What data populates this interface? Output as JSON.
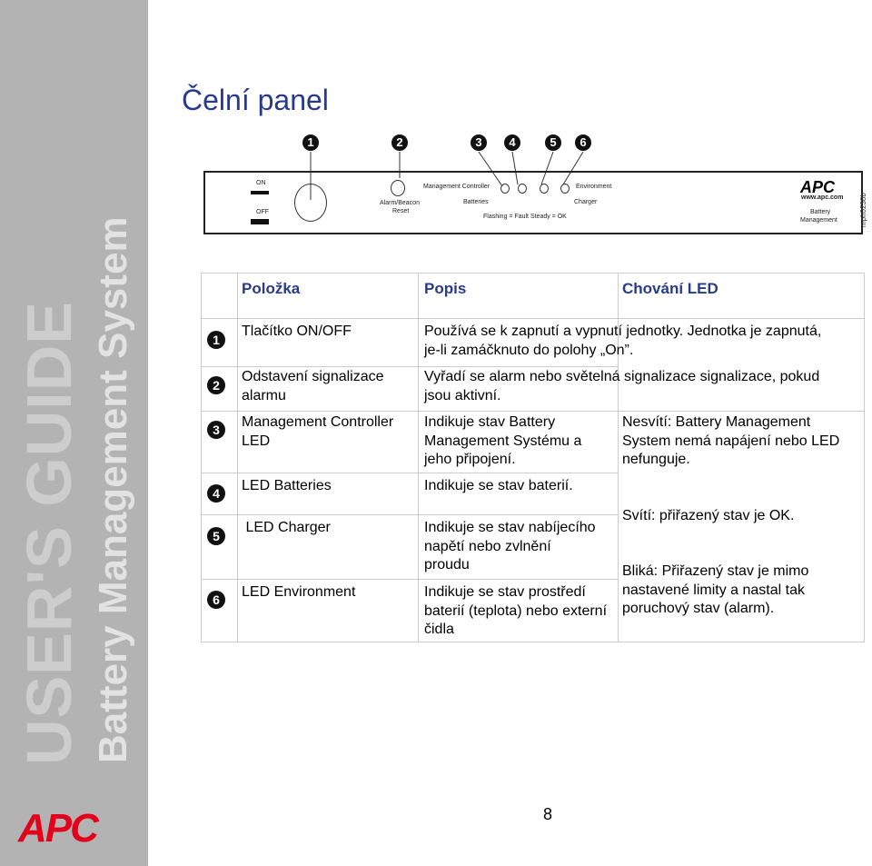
{
  "sidebar": {
    "guide": "USER'S GUIDE",
    "product": "Battery Management System",
    "logo": "APC"
  },
  "title": "Čelní panel",
  "diagram": {
    "numbers": [
      "1",
      "2",
      "3",
      "4",
      "5",
      "6"
    ],
    "on": "ON",
    "off": "OFF",
    "alarm": "Alarm/Beacon",
    "reset": "Reset",
    "mgmt": "Management Controller",
    "batteries": "Batteries",
    "charger": "Charger",
    "environment": "Environment",
    "legend": "Flashing = Fault   Steady = OK",
    "logo": "APC",
    "url": "www.apc.com",
    "product1": "Battery",
    "product2": "Management",
    "code": "mph0238b"
  },
  "table": {
    "headers": [
      "Položka",
      "Popis",
      "Chování LED"
    ],
    "rows": [
      {
        "num": "1",
        "item": "Tlačítko ON/OFF",
        "desc": "Používá se k zapnutí a vypnutí jednotky. Jednotka je zapnutá, je-li zamáčknuto do polohy „On”."
      },
      {
        "num": "2",
        "item": "Odstavení signalizace alarmu",
        "desc": "Vyřadí se alarm nebo světelná signalizace signalizace, pokud  jsou aktivní."
      },
      {
        "num": "3",
        "item": "Management Controller LED",
        "desc": "Indikuje stav Battery Management Systému a jeho připojení."
      },
      {
        "num": "4",
        "item": "LED Batteries",
        "desc": "Indikuje se stav baterií."
      },
      {
        "num": "5",
        "item": " LED Charger",
        "desc": "Indikuje se stav nabíjecího napětí nebo zvlnění proudu"
      },
      {
        "num": "6",
        "item": "LED Environment",
        "desc": "Indikuje se stav prostředí baterií (teplota) nebo externí čidla"
      }
    ],
    "led_behavior": [
      "Nesvítí:  Battery Management System nemá napájení nebo LED nefunguje.",
      "Svítí: přiřazený stav je OK.",
      "Bliká: Přiřazený stav je mimo nastavené limity a nastal tak poruchový stav (alarm)."
    ]
  },
  "page_number": "8"
}
